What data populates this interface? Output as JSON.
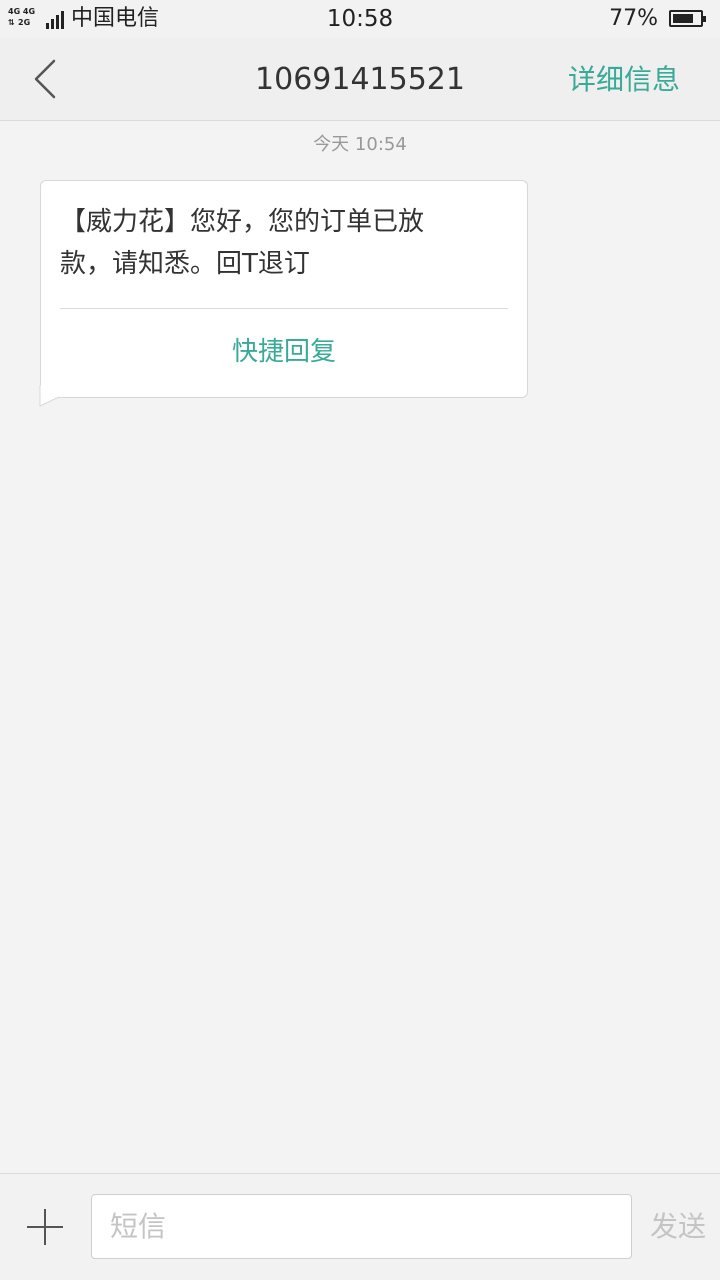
{
  "status_bar": {
    "network_top": "4G 4G",
    "network_bottom": "2G",
    "carrier": "中国电信",
    "time": "10:58",
    "battery_percent": "77%",
    "battery_level": 0.77
  },
  "header": {
    "back_icon": "chevron-left-icon",
    "title": "10691415521",
    "details_label": "详细信息"
  },
  "conversation": {
    "timestamp": "今天  10:54",
    "messages": [
      {
        "line1": "【威力花】您好，您的订单已放",
        "line2": "款，请知悉。回T退订",
        "quick_reply_label": "快捷回复"
      }
    ]
  },
  "composer": {
    "add_icon": "plus-icon",
    "placeholder": "短信",
    "value": "",
    "send_label": "发送"
  },
  "colors": {
    "accent": "#3aaa98",
    "background": "#f3f3f3",
    "disabled_text": "#c4c4c4"
  }
}
